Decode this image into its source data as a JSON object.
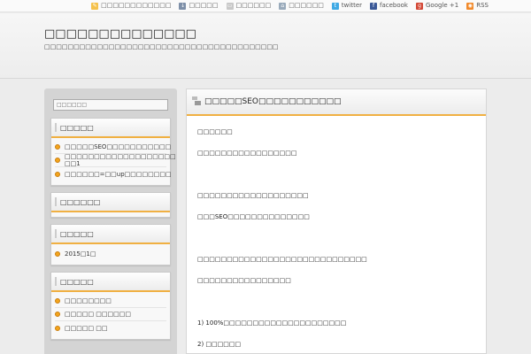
{
  "topnav": [
    {
      "icon": "bookmark-icon",
      "label": "□□□□□□□□□□□□"
    },
    {
      "icon": "download-icon",
      "label": "□□□□□"
    },
    {
      "icon": "document-icon",
      "label": "□□□□□□"
    },
    {
      "icon": "home-icon",
      "label": "□□□□□□"
    },
    {
      "icon": "twitter-icon",
      "label": "twitter"
    },
    {
      "icon": "facebook-icon",
      "label": "facebook"
    },
    {
      "icon": "google-plus-icon",
      "label": "Google +1"
    },
    {
      "icon": "rss-icon",
      "label": "RSS"
    }
  ],
  "header": {
    "title": "□□□□□□□□□□□□□□",
    "description": "□□□□□□□□□□□□□□□□□□□□□□□□□□□□□□□□□□□□□□□□"
  },
  "sidebar": {
    "search_placeholder": "□□□□□□",
    "widgets": [
      {
        "title": "□□□□□",
        "items": [
          "□□□□□SEO□□□□□□□□□□□",
          "□□□□□□□□□□□□□□□□□□□ □□1",
          "□□□□□□=□□up□□□□□□□□"
        ]
      },
      {
        "title": "□□□□□□",
        "items": []
      },
      {
        "title": "□□□□□",
        "items": [
          "2015□1□"
        ]
      },
      {
        "title": "□□□□□",
        "items": [
          "□□□□□□□□",
          "□□□□□ □□□□□□",
          "□□□□□ □□"
        ]
      }
    ]
  },
  "post": {
    "title": "□□□□□SEO□□□□□□□□□□□",
    "lines": [
      "□□□□□□",
      "□□□□□□□□□□□□□□□□□",
      "",
      "□□□□□□□□□□□□□□□□□□□",
      "□□□SEO□□□□□□□□□□□□□□",
      "",
      "□□□□□□□□□□□□□□□□□□□□□□□□□□□□□",
      "□□□□□□□□□□□□□□□□",
      "",
      "1) 100%□□□□□□□□□□□□□□□□□□□□□",
      "2) □□□□□□"
    ]
  }
}
